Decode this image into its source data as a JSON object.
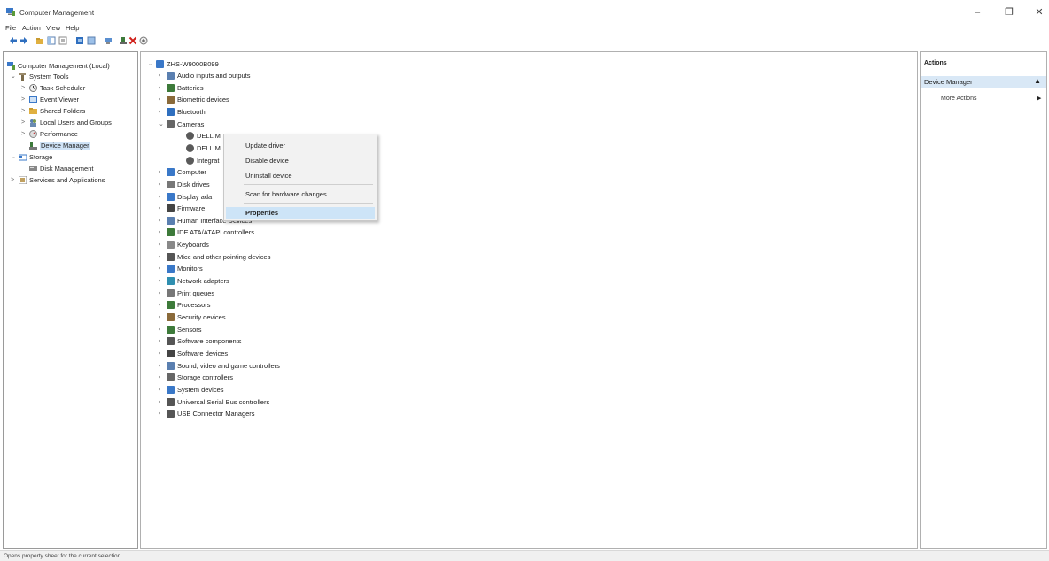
{
  "window": {
    "title": "Computer Management",
    "minimize_glyph": "–",
    "maximize_glyph": "❐",
    "close_glyph": "✕"
  },
  "menu": [
    "File",
    "Action",
    "View",
    "Help"
  ],
  "toolbar_icons": [
    "back-icon",
    "forward-icon",
    "up-folder-icon",
    "show-tree-icon",
    "properties-icon",
    "help-icon",
    "console-tree-icon",
    "scan-hardware-icon",
    "update-driver-icon",
    "uninstall-icon",
    "enable-device-icon"
  ],
  "colors": {
    "selection": "#cfe3f7",
    "context_highlight": "#cde4f7",
    "actions_group": "#d9e8f6",
    "disable_x": "#d0201a"
  },
  "left_tree": {
    "items": [
      {
        "label": "Computer Management (Local)",
        "expander": "",
        "icon": "computer-management-icon"
      },
      {
        "label": "System Tools",
        "expander": "⌄",
        "icon": "tools-icon"
      },
      {
        "label": "Task Scheduler",
        "expander": ">",
        "icon": "clock-icon"
      },
      {
        "label": "Event Viewer",
        "expander": ">",
        "icon": "event-viewer-icon"
      },
      {
        "label": "Shared Folders",
        "expander": ">",
        "icon": "shared-folder-icon"
      },
      {
        "label": "Local Users and Groups",
        "expander": ">",
        "icon": "users-icon"
      },
      {
        "label": "Performance",
        "expander": ">",
        "icon": "performance-icon"
      },
      {
        "label": "Device Manager",
        "expander": "",
        "icon": "device-manager-icon"
      },
      {
        "label": "Storage",
        "expander": "⌄",
        "icon": "storage-icon"
      },
      {
        "label": "Disk Management",
        "expander": "",
        "icon": "disk-icon"
      },
      {
        "label": "Services and Applications",
        "expander": ">",
        "icon": "services-icon"
      }
    ]
  },
  "device_tree": {
    "root": "ZHS-W9000B099",
    "categories": [
      {
        "label": "Audio inputs and outputs",
        "icon": "speaker-icon"
      },
      {
        "label": "Batteries",
        "icon": "battery-icon"
      },
      {
        "label": "Biometric devices",
        "icon": "biometric-icon"
      },
      {
        "label": "Bluetooth",
        "icon": "bluetooth-icon"
      },
      {
        "label": "Cameras",
        "icon": "camera-icon"
      },
      {
        "label": "DELL M",
        "icon": "camera-icon"
      },
      {
        "label": "DELL M",
        "icon": "camera-icon"
      },
      {
        "label": "Integrat",
        "icon": "camera-icon"
      },
      {
        "label": "Computer",
        "icon": "computer-icon"
      },
      {
        "label": "Disk drives",
        "icon": "disk-drive-icon"
      },
      {
        "label": "Display ada",
        "icon": "display-icon"
      },
      {
        "label": "Firmware",
        "icon": "firmware-icon"
      },
      {
        "label": "Human Interface Devices",
        "icon": "hid-icon"
      },
      {
        "label": "IDE ATA/ATAPI controllers",
        "icon": "ide-icon"
      },
      {
        "label": "Keyboards",
        "icon": "keyboard-icon"
      },
      {
        "label": "Mice and other pointing devices",
        "icon": "mouse-icon"
      },
      {
        "label": "Monitors",
        "icon": "monitor-icon"
      },
      {
        "label": "Network adapters",
        "icon": "network-icon"
      },
      {
        "label": "Print queues",
        "icon": "printer-icon"
      },
      {
        "label": "Processors",
        "icon": "processor-icon"
      },
      {
        "label": "Security devices",
        "icon": "security-icon"
      },
      {
        "label": "Sensors",
        "icon": "sensor-icon"
      },
      {
        "label": "Software components",
        "icon": "software-component-icon"
      },
      {
        "label": "Software devices",
        "icon": "software-device-icon"
      },
      {
        "label": "Sound, video and game controllers",
        "icon": "sound-icon"
      },
      {
        "label": "Storage controllers",
        "icon": "storage-controller-icon"
      },
      {
        "label": "System devices",
        "icon": "system-device-icon"
      },
      {
        "label": "Universal Serial Bus controllers",
        "icon": "usb-icon"
      },
      {
        "label": "USB Connector Managers",
        "icon": "usb-connector-icon"
      }
    ]
  },
  "context_menu": {
    "items": [
      "Update driver",
      "Disable device",
      "Uninstall device",
      "Scan for hardware changes",
      "Properties"
    ]
  },
  "actions": {
    "header": "Actions",
    "group": "Device Manager",
    "group_caret": "▲",
    "item": "More Actions",
    "item_arrow": "▶"
  },
  "status": "Opens property sheet for the current selection."
}
